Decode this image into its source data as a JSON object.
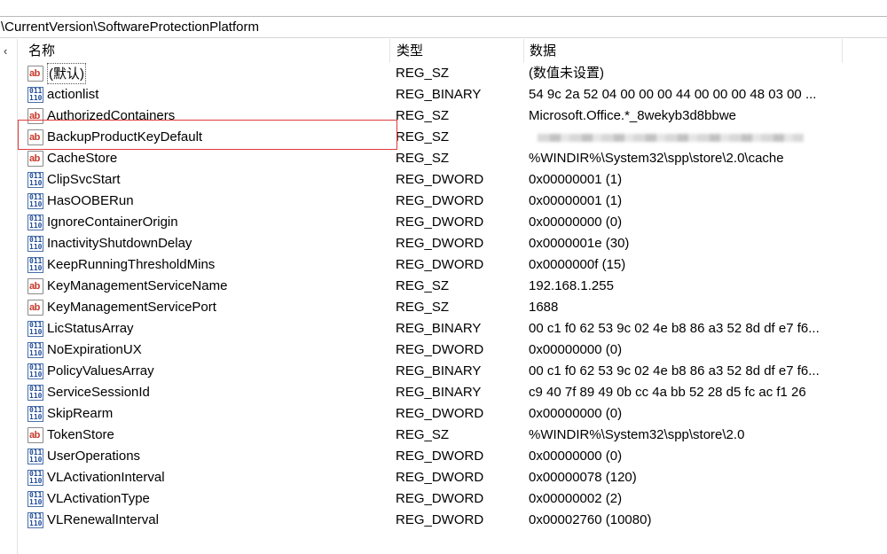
{
  "address": {
    "path": "\\CurrentVersion\\SoftwareProtectionPlatform"
  },
  "tree": {
    "collapse_glyph": "‹"
  },
  "columns": {
    "name": "名称",
    "type": "类型",
    "data": "数据"
  },
  "rows": [
    {
      "name": "(默认)",
      "type": "REG_SZ",
      "data": "(数值未设置)",
      "icon": "string-value-icon"
    },
    {
      "name": "actionlist",
      "type": "REG_BINARY",
      "data": "54 9c 2a 52 04 00 00 00 44 00 00 00 48 03 00 ...",
      "icon": "binary-value-icon"
    },
    {
      "name": "AuthorizedContainers",
      "type": "REG_SZ",
      "data": "Microsoft.Office.*_8wekyb3d8bbwe",
      "icon": "string-value-icon"
    },
    {
      "name": "BackupProductKeyDefault",
      "type": "REG_SZ",
      "data": "",
      "icon": "string-value-icon"
    },
    {
      "name": "CacheStore",
      "type": "REG_SZ",
      "data": "%WINDIR%\\System32\\spp\\store\\2.0\\cache",
      "icon": "string-value-icon"
    },
    {
      "name": "ClipSvcStart",
      "type": "REG_DWORD",
      "data": "0x00000001 (1)",
      "icon": "binary-value-icon"
    },
    {
      "name": "HasOOBERun",
      "type": "REG_DWORD",
      "data": "0x00000001 (1)",
      "icon": "binary-value-icon"
    },
    {
      "name": "IgnoreContainerOrigin",
      "type": "REG_DWORD",
      "data": "0x00000000 (0)",
      "icon": "binary-value-icon"
    },
    {
      "name": "InactivityShutdownDelay",
      "type": "REG_DWORD",
      "data": "0x0000001e (30)",
      "icon": "binary-value-icon"
    },
    {
      "name": "KeepRunningThresholdMins",
      "type": "REG_DWORD",
      "data": "0x0000000f (15)",
      "icon": "binary-value-icon"
    },
    {
      "name": "KeyManagementServiceName",
      "type": "REG_SZ",
      "data": "192.168.1.255",
      "icon": "string-value-icon"
    },
    {
      "name": "KeyManagementServicePort",
      "type": "REG_SZ",
      "data": "1688",
      "icon": "string-value-icon"
    },
    {
      "name": "LicStatusArray",
      "type": "REG_BINARY",
      "data": "00 c1 f0 62 53 9c 02 4e b8 86 a3 52 8d df e7 f6...",
      "icon": "binary-value-icon"
    },
    {
      "name": "NoExpirationUX",
      "type": "REG_DWORD",
      "data": "0x00000000 (0)",
      "icon": "binary-value-icon"
    },
    {
      "name": "PolicyValuesArray",
      "type": "REG_BINARY",
      "data": "00 c1 f0 62 53 9c 02 4e b8 86 a3 52 8d df e7 f6...",
      "icon": "binary-value-icon"
    },
    {
      "name": "ServiceSessionId",
      "type": "REG_BINARY",
      "data": "c9 40 7f 89 49 0b cc 4a bb 52 28 d5 fc ac f1 26",
      "icon": "binary-value-icon"
    },
    {
      "name": "SkipRearm",
      "type": "REG_DWORD",
      "data": "0x00000000 (0)",
      "icon": "binary-value-icon"
    },
    {
      "name": "TokenStore",
      "type": "REG_SZ",
      "data": "%WINDIR%\\System32\\spp\\store\\2.0",
      "icon": "string-value-icon"
    },
    {
      "name": "UserOperations",
      "type": "REG_DWORD",
      "data": "0x00000000 (0)",
      "icon": "binary-value-icon"
    },
    {
      "name": "VLActivationInterval",
      "type": "REG_DWORD",
      "data": "0x00000078 (120)",
      "icon": "binary-value-icon"
    },
    {
      "name": "VLActivationType",
      "type": "REG_DWORD",
      "data": "0x00000002 (2)",
      "icon": "binary-value-icon"
    },
    {
      "name": "VLRenewalInterval",
      "type": "REG_DWORD",
      "data": "0x00002760 (10080)",
      "icon": "binary-value-icon"
    }
  ],
  "icon_glyphs": {
    "string-value-icon": "ab",
    "binary-value-icon": "011\n110"
  },
  "colors": {
    "highlight": "#e03a3a",
    "sz_icon": "#c8392b",
    "bin_icon": "#1f4c9a"
  }
}
